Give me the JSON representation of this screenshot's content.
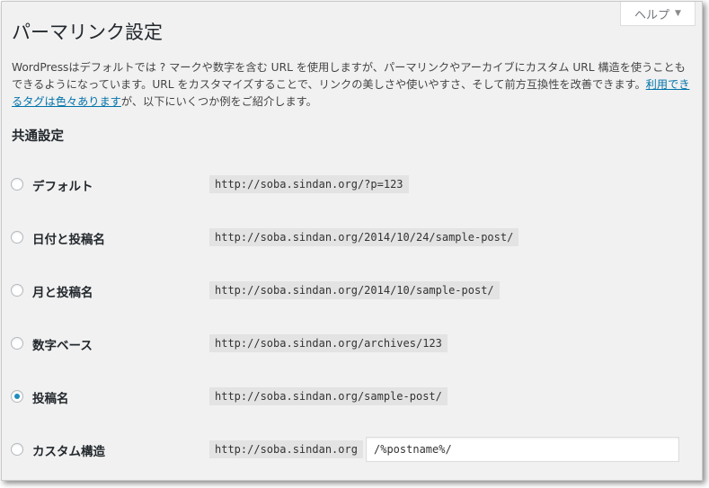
{
  "help_tab": {
    "label": "ヘルプ",
    "arrow": "▼"
  },
  "page": {
    "title": "パーマリンク設定",
    "intro_before_link": "WordPressはデフォルトでは ? マークや数字を含む URL を使用しますが、パーマリンクやアーカイブにカスタム URL 構造を使うこともできるようになっています。URL をカスタマイズすることで、リンクの美しさや使いやすさ、そして前方互換性を改善できます。",
    "intro_link": "利用できるタグは色々あります",
    "intro_after_link": "が、以下にいくつか例をご紹介します。",
    "section_title": "共通設定"
  },
  "options": [
    {
      "label": "デフォルト",
      "example": "http://soba.sindan.org/?p=123",
      "checked": false
    },
    {
      "label": "日付と投稿名",
      "example": "http://soba.sindan.org/2014/10/24/sample-post/",
      "checked": false
    },
    {
      "label": "月と投稿名",
      "example": "http://soba.sindan.org/2014/10/sample-post/",
      "checked": false
    },
    {
      "label": "数字ベース",
      "example": "http://soba.sindan.org/archives/123",
      "checked": false
    },
    {
      "label": "投稿名",
      "example": "http://soba.sindan.org/sample-post/",
      "checked": true
    },
    {
      "label": "カスタム構造",
      "example": "http://soba.sindan.org",
      "checked": false,
      "input_value": "/%postname%/"
    }
  ],
  "colors": {
    "link": "#0073aa",
    "radio_checked": "#1e8cbe",
    "background": "#f1f1f1"
  }
}
